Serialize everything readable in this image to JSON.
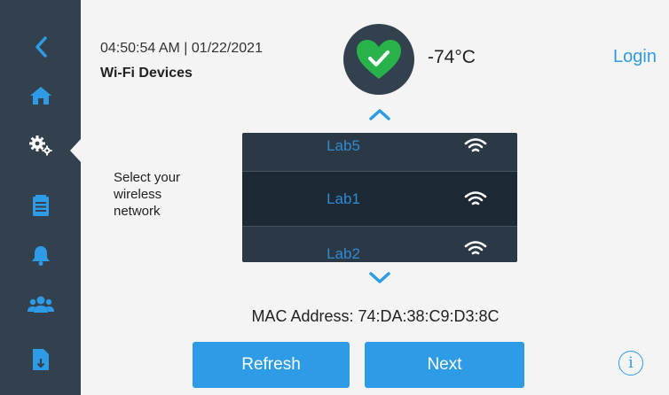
{
  "header": {
    "datetime": "04:50:54 AM | 01/22/2021",
    "title": "Wi-Fi Devices",
    "temperature": "-74°C",
    "status_icon": "heart-check-icon",
    "login_label": "Login"
  },
  "sidebar": {
    "items": [
      {
        "name": "back",
        "icon": "chevron-left-icon"
      },
      {
        "name": "home",
        "icon": "home-icon"
      },
      {
        "name": "settings",
        "icon": "gears-icon",
        "active": true
      },
      {
        "name": "logs",
        "icon": "clipboard-icon"
      },
      {
        "name": "alarms",
        "icon": "bell-icon"
      },
      {
        "name": "users",
        "icon": "users-icon"
      },
      {
        "name": "export",
        "icon": "file-download-icon"
      }
    ]
  },
  "network_picker": {
    "prompt": "Select your\nwireless\nnetwork",
    "networks": [
      {
        "name": "Lab5",
        "icon": "wifi-icon"
      },
      {
        "name": "Lab1",
        "icon": "wifi-icon",
        "selected": true
      },
      {
        "name": "Lab2",
        "icon": "wifi-icon"
      }
    ]
  },
  "mac_address": "MAC Address: 74:DA:38:C9:D3:8C",
  "buttons": {
    "refresh": "Refresh",
    "next": "Next",
    "info": "i"
  },
  "colors": {
    "sidebar": "#33414f",
    "accent": "#2e9be6",
    "status_ok": "#27b24a",
    "picker_bg": "#2b3946"
  }
}
